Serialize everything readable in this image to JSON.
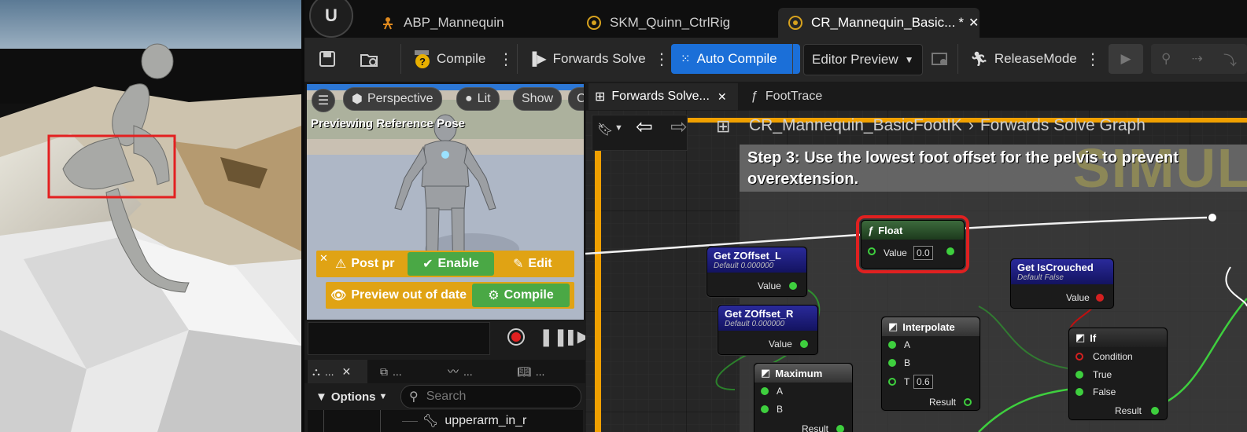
{
  "tabs": [
    {
      "label": "ABP_Mannequin",
      "icon": "anim-blueprint-icon"
    },
    {
      "label": "SKM_Quinn_CtrlRig",
      "icon": "control-rig-icon"
    },
    {
      "label": "CR_Mannequin_Basic...",
      "dirty": "*",
      "icon": "control-rig-icon",
      "active": true
    }
  ],
  "toolbar": {
    "compile": "Compile",
    "forwards_solve": "Forwards Solve",
    "auto_compile": "Auto Compile",
    "editor_preview": "Editor Preview",
    "release_mode": "ReleaseMode"
  },
  "preview": {
    "perspective": "Perspective",
    "lit": "Lit",
    "show": "Show",
    "cut": "C",
    "overlay": "Previewing Reference Pose",
    "post_process": "Post pr",
    "enable": "Enable",
    "edit": "Edit",
    "out_of_date": "Preview out of date",
    "compile": "Compile"
  },
  "bottom": {
    "tab1": "...",
    "tab2": "...",
    "tab3": "...",
    "options": "Options",
    "search_placeholder": "Search",
    "tree_item": "upperarm_in_r"
  },
  "graph_tabs": [
    {
      "label": "Forwards Solve...",
      "active": true
    },
    {
      "label": "FootTrace",
      "active": false
    }
  ],
  "breadcrumb": {
    "asset": "CR_Mannequin_BasicFootIK",
    "graph": "Forwards Solve Graph"
  },
  "comment": {
    "line1": "Step 3: Use the lowest foot offset for the pelvis to prevent",
    "line2": "overextension.",
    "watermark": "SIMUL"
  },
  "nodes": {
    "float": {
      "title": "Float",
      "value_label": "Value",
      "value": "0.0"
    },
    "get_l": {
      "title": "Get ZOffset_L",
      "subtitle": "Default 0.000000",
      "out": "Value"
    },
    "get_r": {
      "title": "Get ZOffset_R",
      "subtitle": "Default 0.000000",
      "out": "Value"
    },
    "crouch": {
      "title": "Get IsCrouched",
      "subtitle": "Default False",
      "out": "Value"
    },
    "interp": {
      "title": "Interpolate",
      "a": "A",
      "b": "B",
      "t": "T",
      "t_value": "0.6",
      "result": "Result"
    },
    "if": {
      "title": "If",
      "condition": "Condition",
      "true": "True",
      "false": "False",
      "result": "Result"
    },
    "max": {
      "title": "Maximum",
      "a": "A",
      "b": "B",
      "result": "Result"
    }
  },
  "colors": {
    "accent_blue": "#1b6fd8",
    "highlight_red": "#e02020",
    "warning_yellow": "#e0a314",
    "enable_green": "#4aa845",
    "comment_orange": "#f0a000"
  }
}
